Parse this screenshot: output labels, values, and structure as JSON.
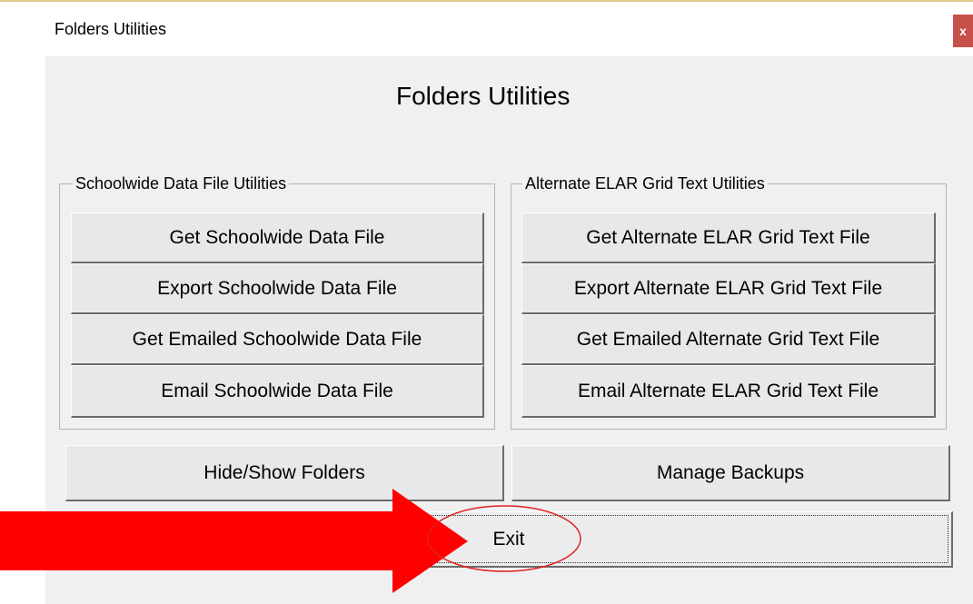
{
  "window": {
    "title": "Folders Utilities",
    "close_label": "x"
  },
  "heading": "Folders Utilities",
  "schoolwide_group": {
    "label": "Schoolwide Data File Utilities",
    "buttons": [
      "Get Schoolwide Data File",
      "Export Schoolwide Data File",
      "Get Emailed Schoolwide Data File",
      "Email Schoolwide Data File"
    ]
  },
  "elar_group": {
    "label": "Alternate ELAR Grid Text Utilities",
    "buttons": [
      "Get Alternate ELAR Grid Text File",
      "Export Alternate ELAR Grid Text File",
      "Get Emailed Alternate Grid Text File",
      "Email Alternate ELAR Grid Text File"
    ]
  },
  "bottom": {
    "hide_show": "Hide/Show Folders",
    "manage_backups": "Manage Backups",
    "exit": "Exit"
  },
  "annotation": {
    "arrow_color": "#ff0000",
    "circle_color": "#e02020"
  }
}
